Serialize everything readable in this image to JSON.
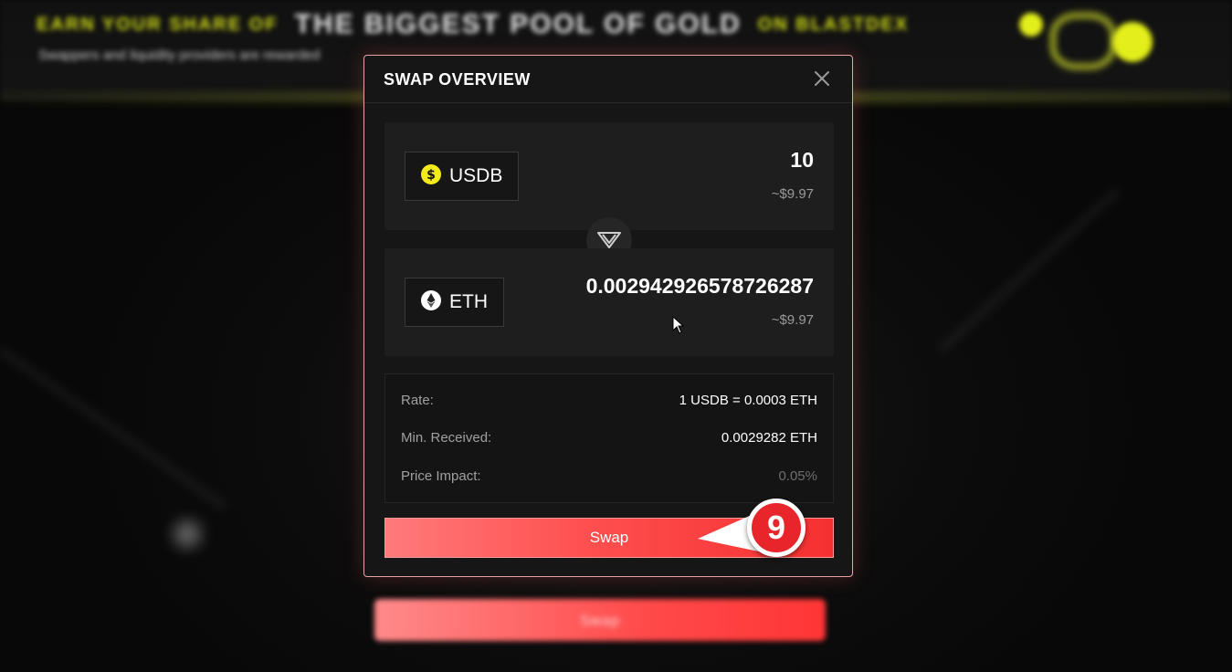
{
  "background": {
    "banner_left": "EARN YOUR SHARE OF",
    "banner_main": "THE BIGGEST POOL OF GOLD",
    "banner_right": "ON BLASTDEX",
    "subtitle": "Swappers and liquidity providers are rewarded",
    "swap_label": "Swap"
  },
  "modal": {
    "title": "SWAP OVERVIEW",
    "close_icon": "close-icon"
  },
  "from": {
    "symbol": "USDB",
    "icon": "usdb-icon",
    "icon_color": "#f2ea1a",
    "amount": "10",
    "usd": "~$9.97"
  },
  "to": {
    "symbol": "ETH",
    "icon": "eth-icon",
    "amount": "0.002942926578726287",
    "usd": "~$9.97"
  },
  "details": {
    "rate_label": "Rate:",
    "rate_value": "1 USDB = 0.0003 ETH",
    "min_label": "Min. Received:",
    "min_value": "0.0029282 ETH",
    "impact_label": "Price Impact:",
    "impact_value": "0.05%"
  },
  "swap_button": "Swap",
  "step_badge": "9",
  "colors": {
    "accent": "#ff4f4f",
    "modal_border": "#e8a3a3",
    "step_badge": "#e8252a"
  }
}
